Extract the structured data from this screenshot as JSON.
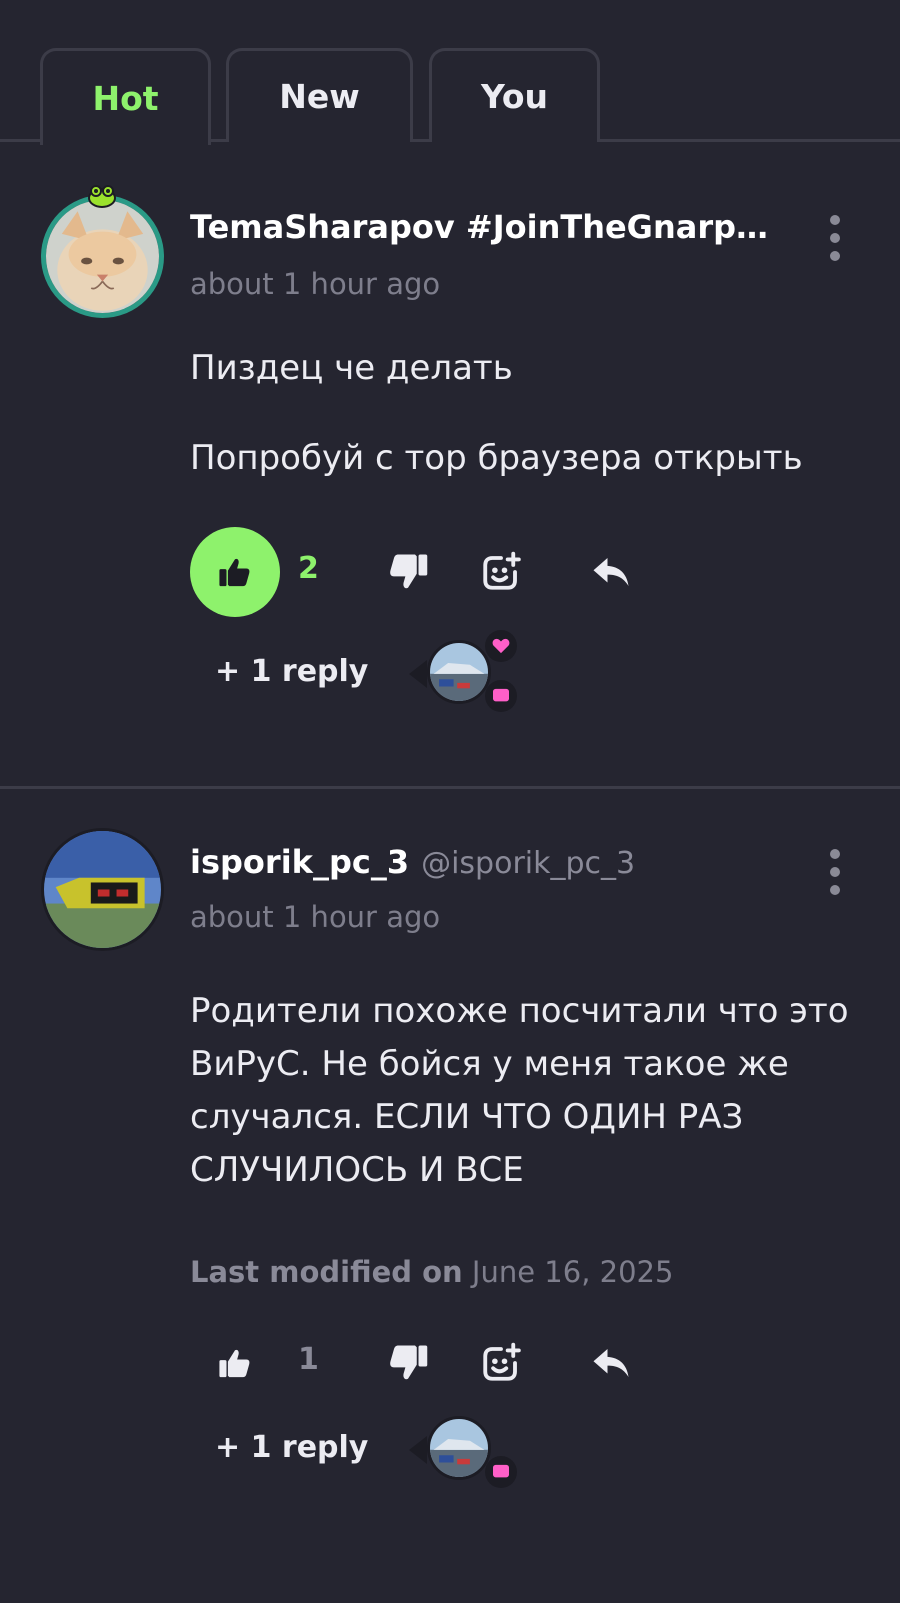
{
  "tabs": [
    {
      "label": "Hot",
      "active": true
    },
    {
      "label": "New",
      "active": false
    },
    {
      "label": "You",
      "active": false
    }
  ],
  "colors": {
    "background": "#252530",
    "accent": "#8ef26c",
    "divider": "#3c3c48",
    "muted": "#7e7e8c",
    "reaction_pink": "#ff5fc8"
  },
  "comments": [
    {
      "username": "TemaSharapov #JoinTheGnarpC...",
      "handle": "",
      "timestamp": "about 1 hour ago",
      "avatar_icon": "cat-avatar",
      "body": [
        "Пиздец че делать",
        "Попробуй с тор браузера открыть"
      ],
      "modified": null,
      "likes": "2",
      "liked": true,
      "replies_label": "+ 1 reply",
      "reply_reactions": [
        "heart-icon",
        "comment-icon"
      ]
    },
    {
      "username": "isporik_pc_3",
      "handle": "@isporik_pc_3",
      "timestamp": "about 1 hour ago",
      "avatar_icon": "pixel-creature-avatar",
      "body": [
        "Родители похоже посчитали что это ВиРуС. Не бойся у меня такое же случался. ЕСЛИ ЧТО ОДИН РАЗ СЛУЧИЛОСЬ И ВСЕ"
      ],
      "modified": {
        "label": "Last modified on",
        "date": "June 16, 2025"
      },
      "likes": "1",
      "liked": false,
      "replies_label": "+ 1 reply",
      "reply_reactions": [
        "comment-icon"
      ]
    }
  ]
}
